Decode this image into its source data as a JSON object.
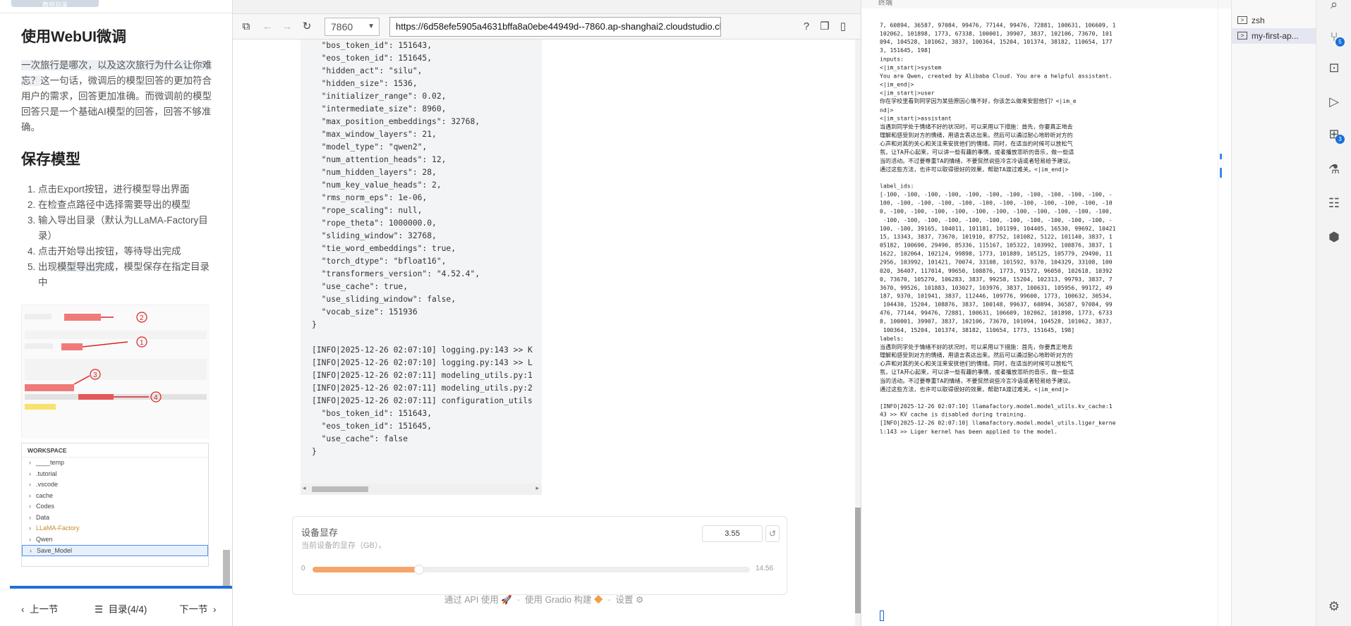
{
  "tutorial": {
    "top_tab": "教程目录",
    "heading1": "使用WebUI微调",
    "para_highlight1": "一次旅行是哪次，以及这次旅行为什么让你难忘？",
    "para_rest": "这一句话，微调后的模型回答的更加符合用户的需求，回答更加准确。而微调前的模型回答只是一个基础AI模型的回答，回答不够准确。",
    "heading2": "保存模型",
    "steps": [
      "点击Export按钮，进行模型导出界面",
      "在检查点路径中选择需要导出的模型",
      "输入导出目录（默认为LLaMA-Factory目录）",
      "点击开始导出按钮，等待导出完成"
    ],
    "step5_prefix": "出现",
    "step5_code": "模型导出完成",
    "step5_suffix": "，模型保存在指定目录中",
    "workspace": {
      "header": "WORKSPACE",
      "items": [
        "____temp",
        ".tutorial",
        ".vscode",
        "cache",
        "Codes",
        "Data",
        "LLaMA-Factory",
        "Qwen",
        "Save_Model"
      ],
      "selected": "Save_Model"
    },
    "footer": {
      "prev": "上一节",
      "toc": "目录(4/4)",
      "next": "下一节"
    }
  },
  "browser": {
    "port": "7860",
    "url": "https://6d58efe5905a4631bffa8a0ebe44949d--7860.ap-shanghai2.cloudstudio.club",
    "log_text": "  \"bos_token_id\": 151643,\n  \"eos_token_id\": 151645,\n  \"hidden_act\": \"silu\",\n  \"hidden_size\": 1536,\n  \"initializer_range\": 0.02,\n  \"intermediate_size\": 8960,\n  \"max_position_embeddings\": 32768,\n  \"max_window_layers\": 21,\n  \"model_type\": \"qwen2\",\n  \"num_attention_heads\": 12,\n  \"num_hidden_layers\": 28,\n  \"num_key_value_heads\": 2,\n  \"rms_norm_eps\": 1e-06,\n  \"rope_scaling\": null,\n  \"rope_theta\": 1000000.0,\n  \"sliding_window\": 32768,\n  \"tie_word_embeddings\": true,\n  \"torch_dtype\": \"bfloat16\",\n  \"transformers_version\": \"4.52.4\",\n  \"use_cache\": true,\n  \"use_sliding_window\": false,\n  \"vocab_size\": 151936\n}\n\n[INFO|2025-12-26 02:07:10] logging.py:143 >> K\n[INFO|2025-12-26 02:07:10] logging.py:143 >> L\n[INFO|2025-12-26 02:07:11] modeling_utils.py:1\n[INFO|2025-12-26 02:07:11] modeling_utils.py:2\n[INFO|2025-12-26 02:07:11] configuration_utils\n  \"bos_token_id\": 151643,\n  \"eos_token_id\": 151645,\n  \"use_cache\": false\n}",
    "memory": {
      "title": "设备显存",
      "subtitle": "当前设备的显存（GB）。",
      "value": "3.55",
      "min": "0",
      "max": "14.56",
      "fraction": 0.244
    },
    "footer": {
      "api": "通过 API 使用",
      "gradio": "使用 Gradio 构建",
      "settings": "设置",
      "sep": "·"
    }
  },
  "terminal": {
    "header": "终端",
    "output": "7, 60894, 36587, 97084, 99476, 77144, 99476, 72881, 100631, 106609, 1\n102062, 101898, 1773, 67338, 100001, 39907, 3837, 102106, 73670, 101\n094, 104528, 101062, 3837, 100364, 15204, 101374, 38182, 110654, 177\n3, 151645, 198]\ninputs:\n<|im_start|>system\nYou are Qwen, created by Alibaba Cloud. You are a helpful assistant.\n<|im_end|>\n<|im_start|>user\n你在学校里看到同学因为某些原因心情不好，你该怎么做来安慰他们？<|im_e\nnd|>\n<|im_start|>assistant\n当遇到同学处于情绪不好的状况时，可以采用以下措施：首先，你要真正地去\n理解和感受到对方的情绪，用语言表达出来。然后可以通过耐心地聆听对方的\n心声和对其的关心和关注来安抚他们的情绪。同时，在适当的时候可以放松气\n氛，让TA开心起来，可以讲一些有趣的事情，或者播放悲听的音乐，做一些适\n当的活动。不过要尊重TA的情绪，不要贸然说些冷言冷语或者轻易给予建议。\n通过这些方法，也许可以取得很好的效果，帮助TA渡过难关。<|im_end|>\n\nlabel_ids:\n[-100, -100, -100, -100, -100, -100, -100, -100, -100, -100, -100, -\n100, -100, -100, -100, -100, -100, -100, -100, -100, -100, -100, -10\n0, -100, -100, -100, -100, -100, -100, -100, -100, -100, -100, -100,\n -100, -100, -100, -100, -100, -100, -100, -100, -100, -100, -100, -\n100, -100, 39165, 104011, 101181, 101199, 104405, 16530, 99692, 10421\n15, 13343, 3837, 73670, 101910, 87752, 101082, 5122, 101140, 3837, 1\n05182, 100690, 29490, 85336, 115167, 105322, 103992, 108876, 3837, 1\n1622, 102064, 102124, 99898, 1773, 101889, 105125, 105779, 29490, 11\n2956, 103992, 101421, 70074, 33108, 101592, 9370, 104329, 33108, 100\n020, 36407, 117014, 99650, 108876, 1773, 91572, 96050, 102618, 10392\n0, 73670, 105270, 106283, 3837, 99258, 15204, 102313, 99793, 3837, 7\n3670, 99526, 101883, 103027, 103976, 3837, 100631, 105956, 99172, 49\n187, 9370, 101941, 3837, 112446, 109776, 99600, 1773, 100632, 30534,\n 104430, 15204, 108876, 3837, 100148, 99637, 60894, 36587, 97084, 99\n476, 77144, 99476, 72881, 100631, 106609, 102062, 101898, 1773, 6733\n8, 100001, 39907, 3837, 102106, 73670, 101094, 104528, 101062, 3837,\n 100364, 15204, 101374, 38182, 110654, 1773, 151645, 198]\nlabels:\n当遇到同学处于情绪不好的状况时，可以采用以下措施：首先，你要真正地去\n理解和感受到对方的情绪，用语言表达出来。然后可以通过耐心地聆听对方的\n心声和对其的关心和关注来安抚他们的情绪。同时，在适当的时候可以放松气\n氛，让TA开心起来，可以讲一些有趣的事情，或者播放悲听的音乐，做一些适\n当的活动。不过要尊重TA的情绪，不要贸然说些冷言冷语或者轻易给予建议。\n通过这些方法，也许可以取得很好的效果，帮助TA渡过难关。<|im_end|>\n\n[INFO|2025-12-26 02:07:10] llamafactory.model.model_utils.kv_cache:1\n43 >> KV cache is disabled during training.\n[INFO|2025-12-26 02:07:10] llamafactory.model.model_utils.liger_kerne\nl:143 >> Liger kernel has been applied to the model."
  },
  "terminal_list": [
    {
      "label": "zsh",
      "active": false
    },
    {
      "label": "my-first-ap...",
      "active": true
    }
  ],
  "activity_bar": {
    "icons": [
      "search-icon",
      "source-control-icon",
      "terminal-icon",
      "run-debug-icon",
      "extensions-icon",
      "testing-icon",
      "database-icon",
      "cube-icon",
      "gear-icon"
    ],
    "badges": {
      "source_control": "5",
      "extensions": "3"
    }
  },
  "colors": {
    "accent": "#1e6fd9",
    "slider_fill": "#f5a56a",
    "highlight": "#eceff3"
  }
}
